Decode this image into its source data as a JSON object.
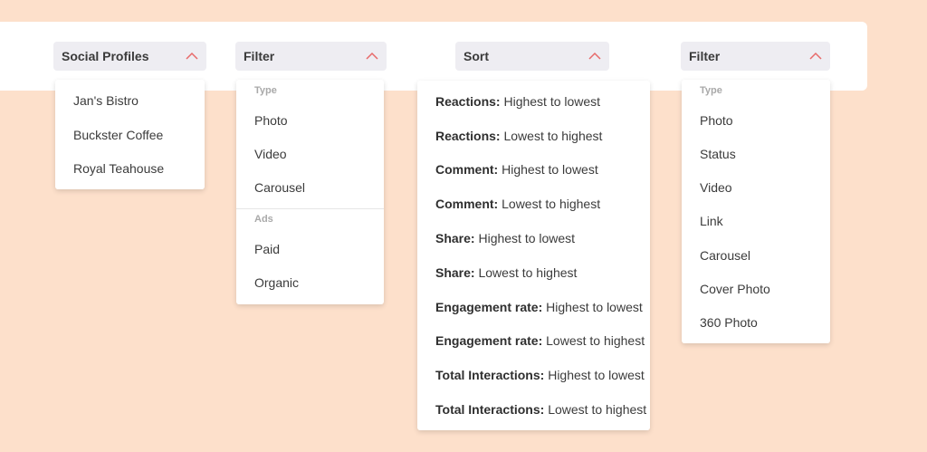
{
  "colors": {
    "background": "#fde0cb",
    "chevron": "#e86a6a",
    "trigger_bg": "#eeedf2"
  },
  "icons": {
    "chevron": "chevron-up-icon"
  },
  "social_profiles": {
    "label": "Social Profiles",
    "items": [
      "Jan's Bistro",
      "Buckster Coffee",
      "Royal Teahouse"
    ]
  },
  "filter1": {
    "label": "Filter",
    "type_header": "Type",
    "type_items": [
      "Photo",
      "Video",
      "Carousel"
    ],
    "ads_header": "Ads",
    "ads_items": [
      "Paid",
      "Organic"
    ]
  },
  "sort": {
    "label": "Sort",
    "items": [
      {
        "key": "Reactions:",
        "value": "Highest to lowest"
      },
      {
        "key": "Reactions:",
        "value": "Lowest to highest"
      },
      {
        "key": "Comment:",
        "value": "Highest to lowest"
      },
      {
        "key": "Comment:",
        "value": "Lowest to highest"
      },
      {
        "key": "Share:",
        "value": "Highest to lowest"
      },
      {
        "key": "Share:",
        "value": "Lowest to highest"
      },
      {
        "key": "Engagement rate:",
        "value": "Highest to lowest"
      },
      {
        "key": "Engagement rate:",
        "value": "Lowest to highest"
      },
      {
        "key": "Total Interactions:",
        "value": "Highest to lowest"
      },
      {
        "key": "Total Interactions:",
        "value": "Lowest to highest"
      }
    ]
  },
  "filter2": {
    "label": "Filter",
    "type_header": "Type",
    "items": [
      "Photo",
      "Status",
      "Video",
      "Link",
      "Carousel",
      "Cover Photo",
      "360 Photo"
    ]
  }
}
